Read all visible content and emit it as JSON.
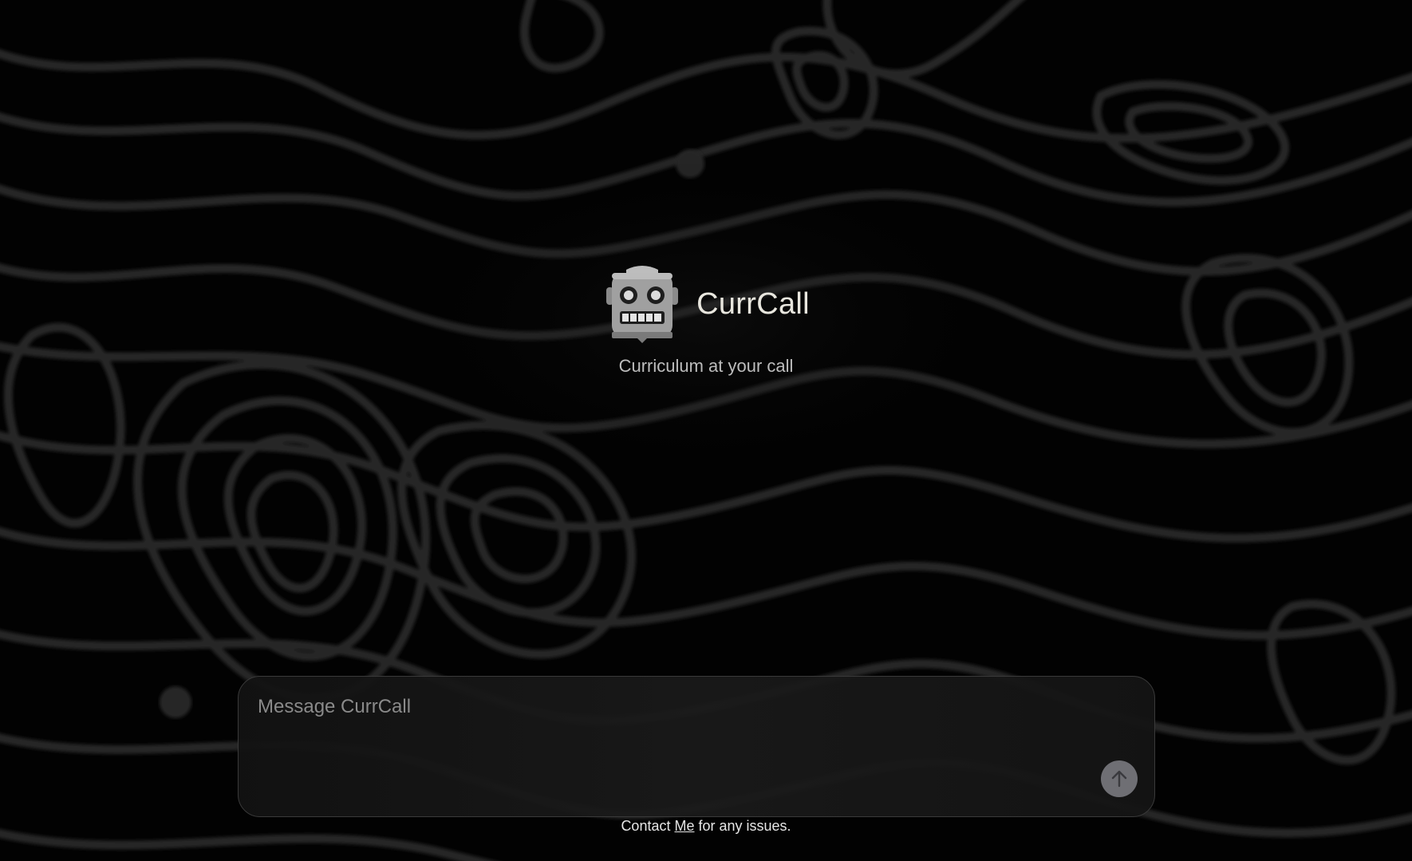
{
  "app": {
    "name": "CurrCall",
    "tagline": "Curriculum at your call"
  },
  "composer": {
    "placeholder": "Message CurrCall",
    "value": ""
  },
  "footer": {
    "prefix": "Contact ",
    "link_label": "Me",
    "suffix": " for any issues."
  },
  "icons": {
    "logo": "robot-icon",
    "send": "arrow-up-icon"
  },
  "colors": {
    "background": "#020202",
    "contour_lines": "#262626",
    "brand_text": "#e8e6de",
    "send_button": "#6f6f74"
  }
}
